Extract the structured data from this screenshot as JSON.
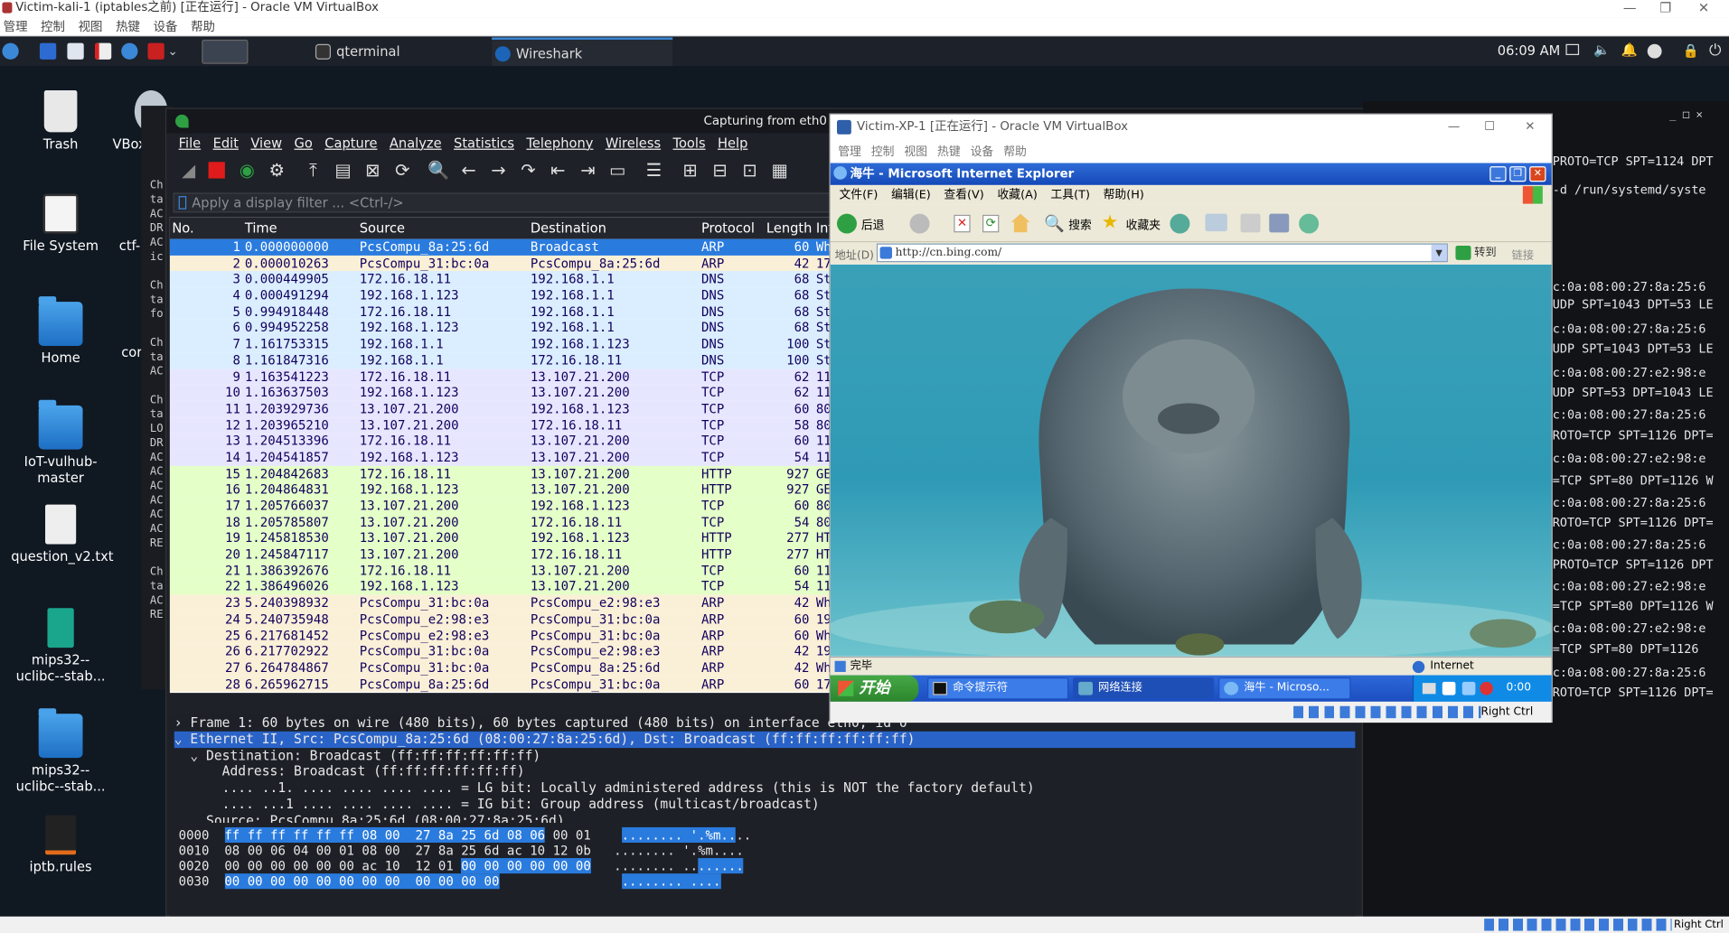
{
  "host": {
    "title": "Victim-kali-1 (iptables之前) [正在运行] - Oracle VM VirtualBox",
    "menu": [
      "管理",
      "控制",
      "视图",
      "热键",
      "设备",
      "帮助"
    ],
    "status_right": "Right Ctrl"
  },
  "panel": {
    "tasks": [
      {
        "label": "qterminal"
      },
      {
        "label": "Wireshark"
      }
    ],
    "clock": "06:09 AM"
  },
  "desktop": {
    "icons": [
      {
        "label": "Trash"
      },
      {
        "label": "VBox"
      },
      {
        "label": "File System"
      },
      {
        "label": "ctf-"
      },
      {
        "label": "Home"
      },
      {
        "label": "cor"
      },
      {
        "label": "IoT-vulhub-master"
      },
      {
        "label": "question_v2.txt"
      },
      {
        "label": "mips32--uclibc--stab..."
      },
      {
        "label": "mips32--uclibc--stab..."
      },
      {
        "label": "iptb.rules"
      }
    ]
  },
  "terminal_left": {
    "lines": [
      "Ch",
      "ta",
      "AC",
      "DR",
      "AC",
      "ic",
      "",
      "Ch",
      "ta",
      "fo",
      "",
      "Ch",
      "ta",
      "AC",
      "",
      "Ch",
      "ta",
      "LO",
      "DR",
      "AC",
      "AC",
      "AC",
      "AC",
      "AC",
      "AC",
      "RE",
      "",
      "Ch",
      "ta",
      "AC",
      "RE"
    ]
  },
  "terminal_right": {
    "lines": [
      "PROTO=TCP SPT=1124 DPT",
      "-d /run/systemd/syste",
      "c:0a:08:00:27:8a:25:6",
      "UDP SPT=1043 DPT=53 LE",
      "c:0a:08:00:27:8a:25:6",
      "UDP SPT=1043 DPT=53 LE",
      "c:0a:08:00:27:e2:98:e",
      "UDP SPT=53 DPT=1043 LE",
      "c:0a:08:00:27:8a:25:6",
      "ROTO=TCP SPT=1126 DPT=",
      "c:0a:08:00:27:e2:98:e",
      "=TCP SPT=80 DPT=1126 W",
      "c:0a:08:00:27:8a:25:6",
      "ROTO=TCP SPT=1126 DPT=",
      "c:0a:08:00:27:8a:25:6",
      "PROTO=TCP SPT=1126 DPT",
      "c:0a:08:00:27:e2:98:e",
      "=TCP SPT=80 DPT=1126 W",
      "c:0a:08:00:27:e2:98:e",
      "=TCP SPT=80 DPT=1126",
      "c:0a:08:00:27:8a:25:6",
      "ROTO=TCP SPT=1126 DPT="
    ]
  },
  "wireshark": {
    "title": "Capturing from eth0",
    "menu": [
      "File",
      "Edit",
      "View",
      "Go",
      "Capture",
      "Analyze",
      "Statistics",
      "Telephony",
      "Wireless",
      "Tools",
      "Help"
    ],
    "filter_placeholder": "Apply a display filter ... <Ctrl-/>",
    "columns": [
      "No.",
      "Time",
      "Source",
      "Destination",
      "Protocol",
      "Length",
      "Inf"
    ],
    "packets": [
      {
        "no": "1",
        "time": "0.000000000",
        "src": "PcsCompu_8a:25:6d",
        "dst": "Broadcast",
        "proto": "ARP",
        "len": "60",
        "info": "Wh",
        "color": "#2a7bde",
        "text": "#ffffff"
      },
      {
        "no": "2",
        "time": "0.000010263",
        "src": "PcsCompu_31:bc:0a",
        "dst": "PcsCompu_8a:25:6d",
        "proto": "ARP",
        "len": "42",
        "info": "17",
        "color": "#faf0d7",
        "text": "#12005e"
      },
      {
        "no": "3",
        "time": "0.000449905",
        "src": "172.16.18.11",
        "dst": "192.168.1.1",
        "proto": "DNS",
        "len": "68",
        "info": "St",
        "color": "#daeeff",
        "text": "#12005e"
      },
      {
        "no": "4",
        "time": "0.000491294",
        "src": "192.168.1.123",
        "dst": "192.168.1.1",
        "proto": "DNS",
        "len": "68",
        "info": "St",
        "color": "#daeeff",
        "text": "#12005e"
      },
      {
        "no": "5",
        "time": "0.994918448",
        "src": "172.16.18.11",
        "dst": "192.168.1.1",
        "proto": "DNS",
        "len": "68",
        "info": "St",
        "color": "#daeeff",
        "text": "#12005e"
      },
      {
        "no": "6",
        "time": "0.994952258",
        "src": "192.168.1.123",
        "dst": "192.168.1.1",
        "proto": "DNS",
        "len": "68",
        "info": "St",
        "color": "#daeeff",
        "text": "#12005e"
      },
      {
        "no": "7",
        "time": "1.161753315",
        "src": "192.168.1.1",
        "dst": "192.168.1.123",
        "proto": "DNS",
        "len": "100",
        "info": "St",
        "color": "#daeeff",
        "text": "#12005e"
      },
      {
        "no": "8",
        "time": "1.161847316",
        "src": "192.168.1.1",
        "dst": "172.16.18.11",
        "proto": "DNS",
        "len": "100",
        "info": "St",
        "color": "#daeeff",
        "text": "#12005e"
      },
      {
        "no": "9",
        "time": "1.163541223",
        "src": "172.16.18.11",
        "dst": "13.107.21.200",
        "proto": "TCP",
        "len": "62",
        "info": "11",
        "color": "#e7e6ff",
        "text": "#12005e"
      },
      {
        "no": "10",
        "time": "1.163637503",
        "src": "192.168.1.123",
        "dst": "13.107.21.200",
        "proto": "TCP",
        "len": "62",
        "info": "11",
        "color": "#e7e6ff",
        "text": "#12005e"
      },
      {
        "no": "11",
        "time": "1.203929736",
        "src": "13.107.21.200",
        "dst": "192.168.1.123",
        "proto": "TCP",
        "len": "60",
        "info": "80",
        "color": "#e7e6ff",
        "text": "#12005e"
      },
      {
        "no": "12",
        "time": "1.203965210",
        "src": "13.107.21.200",
        "dst": "172.16.18.11",
        "proto": "TCP",
        "len": "58",
        "info": "80",
        "color": "#e7e6ff",
        "text": "#12005e"
      },
      {
        "no": "13",
        "time": "1.204513396",
        "src": "172.16.18.11",
        "dst": "13.107.21.200",
        "proto": "TCP",
        "len": "60",
        "info": "11",
        "color": "#e7e6ff",
        "text": "#12005e"
      },
      {
        "no": "14",
        "time": "1.204541857",
        "src": "192.168.1.123",
        "dst": "13.107.21.200",
        "proto": "TCP",
        "len": "54",
        "info": "11",
        "color": "#e7e6ff",
        "text": "#12005e"
      },
      {
        "no": "15",
        "time": "1.204842683",
        "src": "172.16.18.11",
        "dst": "13.107.21.200",
        "proto": "HTTP",
        "len": "927",
        "info": "GE",
        "color": "#e4ffc7",
        "text": "#12005e"
      },
      {
        "no": "16",
        "time": "1.204864831",
        "src": "192.168.1.123",
        "dst": "13.107.21.200",
        "proto": "HTTP",
        "len": "927",
        "info": "GE",
        "color": "#e4ffc7",
        "text": "#12005e"
      },
      {
        "no": "17",
        "time": "1.205766037",
        "src": "13.107.21.200",
        "dst": "192.168.1.123",
        "proto": "TCP",
        "len": "60",
        "info": "80",
        "color": "#e4ffc7",
        "text": "#12005e"
      },
      {
        "no": "18",
        "time": "1.205785807",
        "src": "13.107.21.200",
        "dst": "172.16.18.11",
        "proto": "TCP",
        "len": "54",
        "info": "80",
        "color": "#e4ffc7",
        "text": "#12005e"
      },
      {
        "no": "19",
        "time": "1.245818530",
        "src": "13.107.21.200",
        "dst": "192.168.1.123",
        "proto": "HTTP",
        "len": "277",
        "info": "HT",
        "color": "#e4ffc7",
        "text": "#12005e"
      },
      {
        "no": "20",
        "time": "1.245847117",
        "src": "13.107.21.200",
        "dst": "172.16.18.11",
        "proto": "HTTP",
        "len": "277",
        "info": "HT",
        "color": "#e4ffc7",
        "text": "#12005e"
      },
      {
        "no": "21",
        "time": "1.386392676",
        "src": "172.16.18.11",
        "dst": "13.107.21.200",
        "proto": "TCP",
        "len": "60",
        "info": "11",
        "color": "#e4ffc7",
        "text": "#12005e"
      },
      {
        "no": "22",
        "time": "1.386496026",
        "src": "192.168.1.123",
        "dst": "13.107.21.200",
        "proto": "TCP",
        "len": "54",
        "info": "11",
        "color": "#e4ffc7",
        "text": "#12005e"
      },
      {
        "no": "23",
        "time": "5.240398932",
        "src": "PcsCompu_31:bc:0a",
        "dst": "PcsCompu_e2:98:e3",
        "proto": "ARP",
        "len": "42",
        "info": "Wh",
        "color": "#faf0d7",
        "text": "#12005e"
      },
      {
        "no": "24",
        "time": "5.240735948",
        "src": "PcsCompu_e2:98:e3",
        "dst": "PcsCompu_31:bc:0a",
        "proto": "ARP",
        "len": "60",
        "info": "19",
        "color": "#faf0d7",
        "text": "#12005e"
      },
      {
        "no": "25",
        "time": "6.217681452",
        "src": "PcsCompu_e2:98:e3",
        "dst": "PcsCompu_31:bc:0a",
        "proto": "ARP",
        "len": "60",
        "info": "Wh",
        "color": "#faf0d7",
        "text": "#12005e"
      },
      {
        "no": "26",
        "time": "6.217702922",
        "src": "PcsCompu_31:bc:0a",
        "dst": "PcsCompu_e2:98:e3",
        "proto": "ARP",
        "len": "42",
        "info": "19",
        "color": "#faf0d7",
        "text": "#12005e"
      },
      {
        "no": "27",
        "time": "6.264784867",
        "src": "PcsCompu_31:bc:0a",
        "dst": "PcsCompu_8a:25:6d",
        "proto": "ARP",
        "len": "42",
        "info": "Wh",
        "color": "#faf0d7",
        "text": "#12005e"
      },
      {
        "no": "28",
        "time": "6.265962715",
        "src": "PcsCompu_8a:25:6d",
        "dst": "PcsCompu_31:bc:0a",
        "proto": "ARP",
        "len": "60",
        "info": "17",
        "color": "#faf0d7",
        "text": "#12005e"
      }
    ],
    "details": [
      {
        "text": "› Frame 1: 60 bytes on wire (480 bits), 60 bytes captured (480 bits) on interface eth0, id 0",
        "sel": false
      },
      {
        "text": "⌄ Ethernet II, Src: PcsCompu_8a:25:6d (08:00:27:8a:25:6d), Dst: Broadcast (ff:ff:ff:ff:ff:ff)",
        "sel": true
      },
      {
        "text": "  ⌄ Destination: Broadcast (ff:ff:ff:ff:ff:ff)",
        "sel": false
      },
      {
        "text": "      Address: Broadcast (ff:ff:ff:ff:ff:ff)",
        "sel": false
      },
      {
        "text": "      .... ..1. .... .... .... .... = LG bit: Locally administered address (this is NOT the factory default)",
        "sel": false
      },
      {
        "text": "      .... ...1 .... .... .... .... = IG bit: Group address (multicast/broadcast)",
        "sel": false
      },
      {
        "text": "    Source: PcsCompu_8a:25:6d (08:00:27:8a:25:6d)",
        "sel": false
      }
    ],
    "hex": [
      {
        "off": "0000",
        "a": "ff ff ff ff ff ff 08 00  27 8a 25 6d 08 06",
        "b": " 00 01",
        "asc_a": "........ '.%m..",
        "asc_b": ".."
      },
      {
        "off": "0010",
        "a": "",
        "b": "08 00 06 04 00 01 08 00  27 8a 25 6d ac 10 12 0b",
        "asc_a": "",
        "asc_b": "........ '.%m...."
      },
      {
        "off": "0020",
        "a": "",
        "b": "00 00 00 00 00 00 ac 10  12 01 ",
        "c": "00 00 00 00 00 00",
        "asc_a": "",
        "asc_b": "........ ..",
        "asc_c": "......"
      },
      {
        "off": "0030",
        "a": "00 00 00 00 00 00 00 00  00 00 00 00",
        "b": "",
        "asc_a": "........ ....",
        "asc_b": ""
      }
    ]
  },
  "xp": {
    "title": "Victim-XP-1 [正在运行] - Oracle VM VirtualBox",
    "menu": [
      "管理",
      "控制",
      "视图",
      "热键",
      "设备",
      "帮助"
    ],
    "ie_title": "海牛 - Microsoft Internet Explorer",
    "ie_menu": [
      "文件(F)",
      "编辑(E)",
      "查看(V)",
      "收藏(A)",
      "工具(T)",
      "帮助(H)"
    ],
    "toolbar": {
      "back": "后退",
      "search": "搜索",
      "favorites": "收藏夹"
    },
    "address_label": "地址(D)",
    "address": "http://cn.bing.com/",
    "go": "转到",
    "links": "链接",
    "status": "完毕",
    "zone": "Internet",
    "start": "开始",
    "tasks": [
      {
        "label": "命令提示符"
      },
      {
        "label": "网络连接"
      },
      {
        "label": "海牛 - Microso..."
      }
    ],
    "tray_time": "0:00",
    "host_key": "Right Ctrl"
  }
}
